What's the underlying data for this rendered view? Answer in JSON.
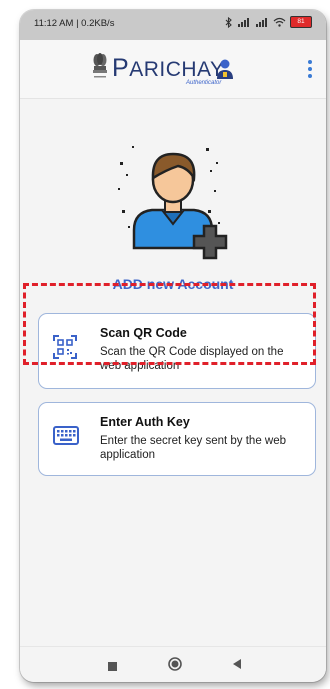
{
  "status_bar": {
    "time_speed": "11:12 AM | 0.2KB/s",
    "battery": "81"
  },
  "app_header": {
    "logo_text": "ARICHAY",
    "logo_p": "P",
    "logo_subtitle": "Authenticator",
    "emblem_icon": "national-emblem-icon",
    "menu_icon": "more-vertical-icon"
  },
  "main": {
    "illustration": "user-add-illustration",
    "heading": "ADD new Account",
    "options": [
      {
        "title": "Scan QR Code",
        "description": "Scan the QR Code displayed on the web application",
        "icon": "qr-scan-icon"
      },
      {
        "title": "Enter Auth Key",
        "description": "Enter the secret key sent by the web application",
        "icon": "keyboard-icon"
      }
    ]
  },
  "nav_bar": {
    "recent_icon": "square-recent-apps-icon",
    "home_icon": "circle-home-icon",
    "back_icon": "triangle-back-icon"
  },
  "colors": {
    "accent": "#3f66c8",
    "card_border": "#9fb6dc",
    "highlight": "#e0202a",
    "logo": "#263a73"
  }
}
